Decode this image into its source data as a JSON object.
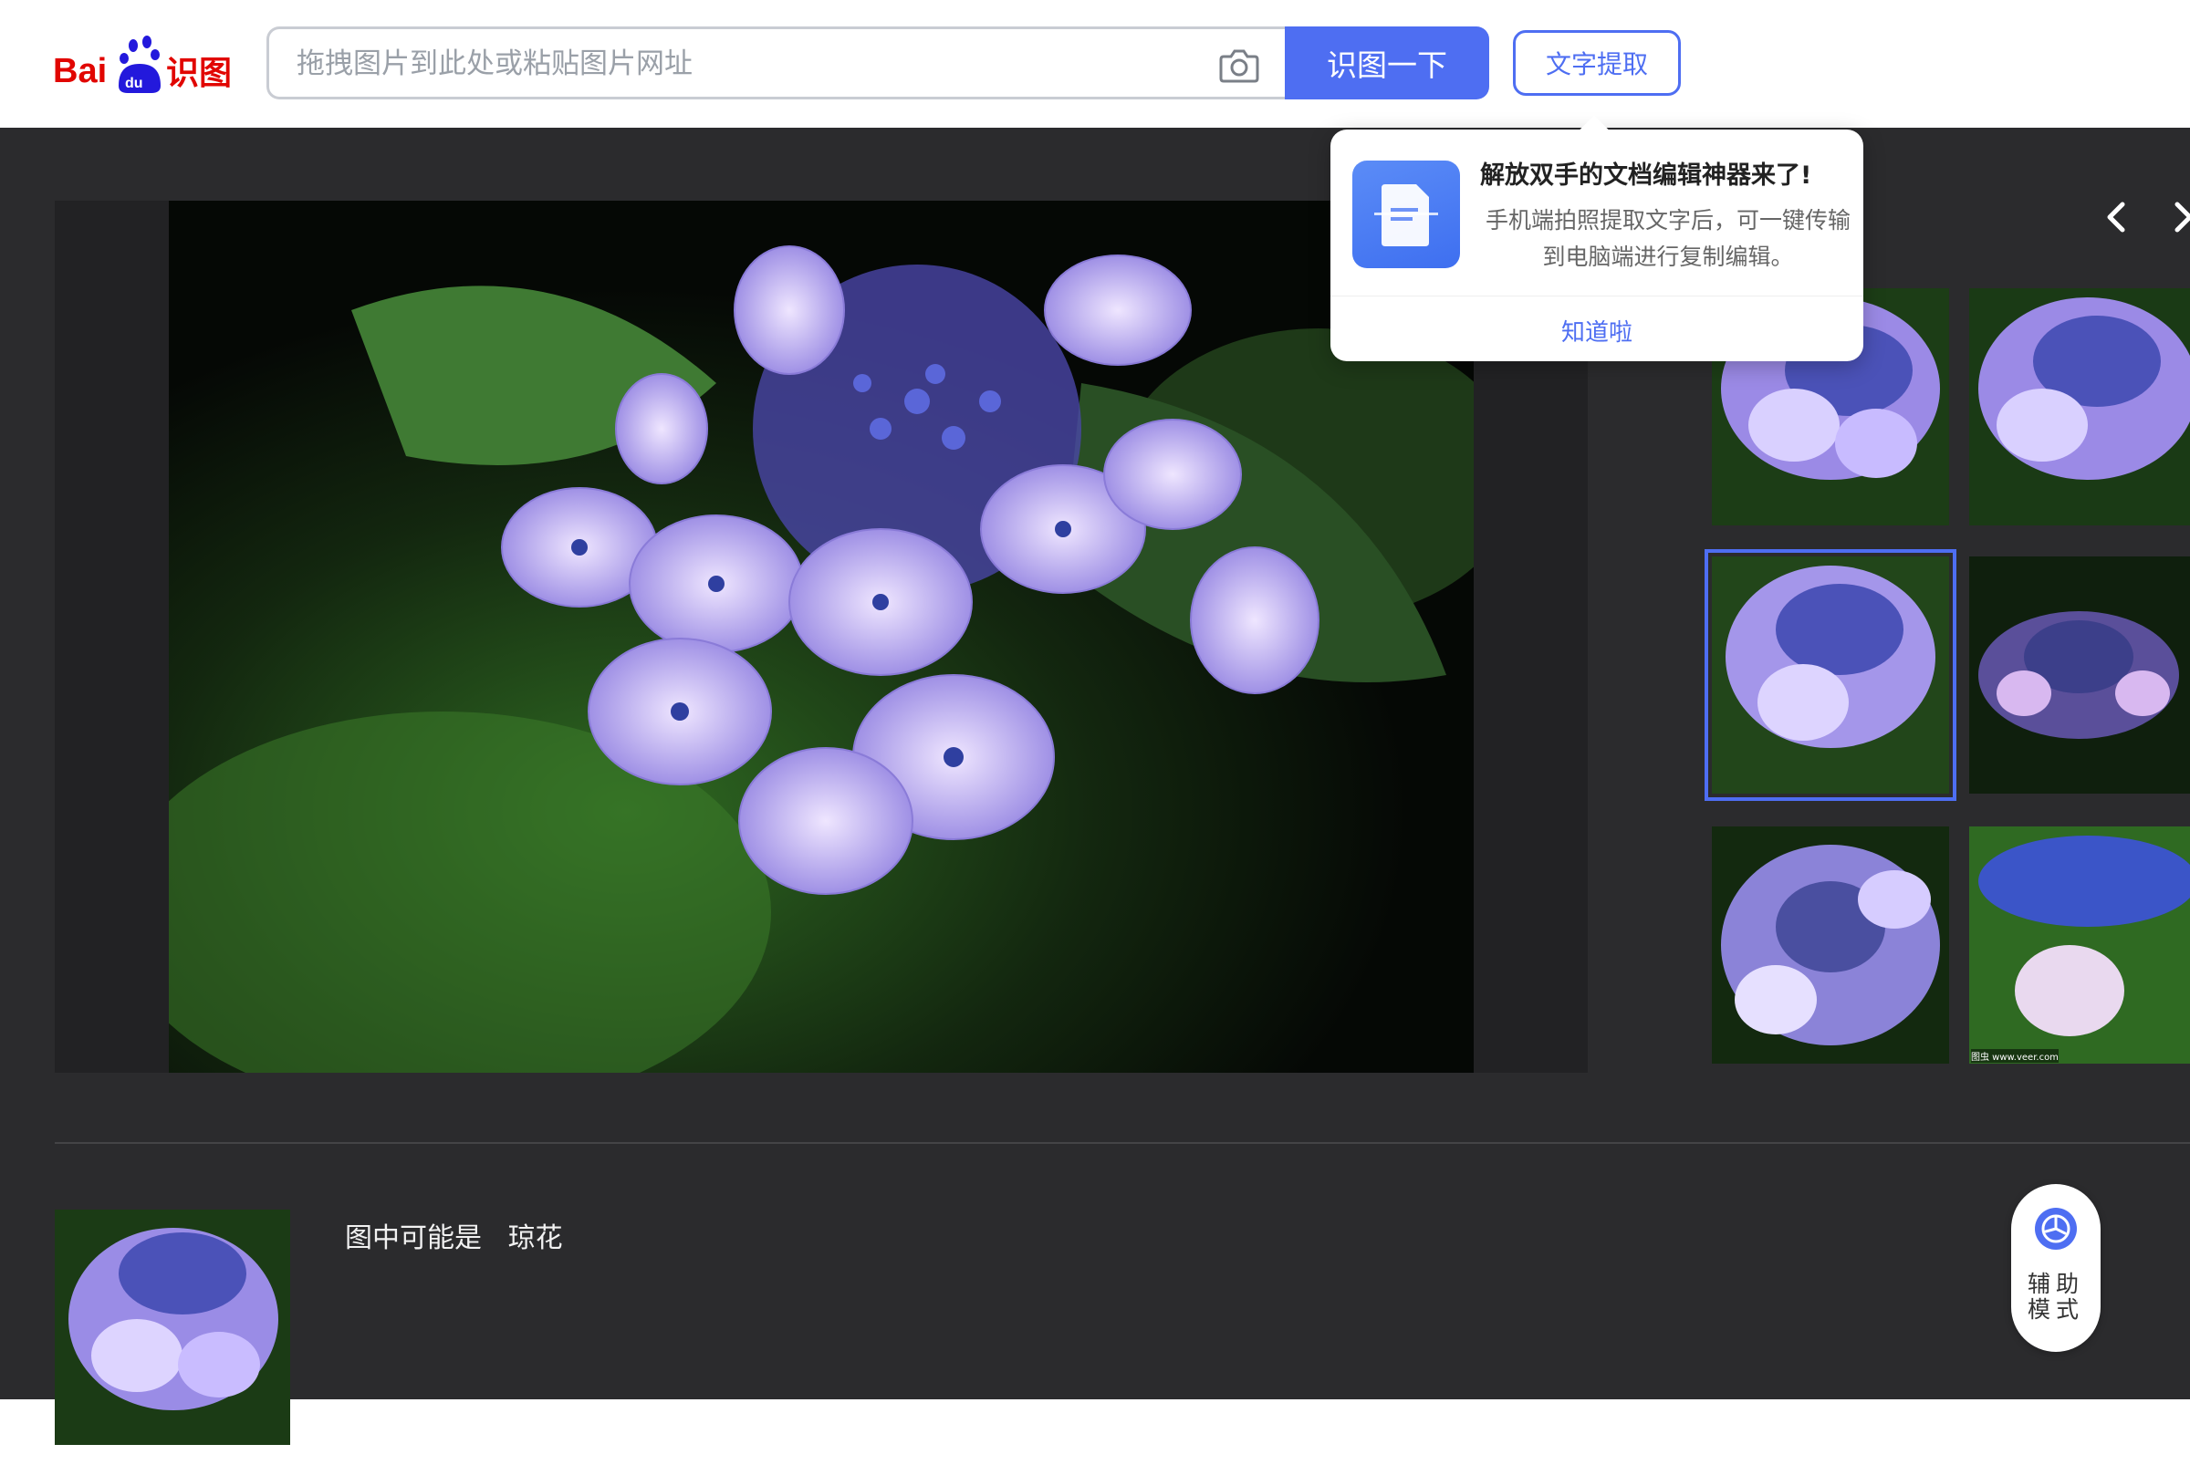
{
  "header": {
    "logo_text": "Bai du 识图",
    "search_placeholder": "拖拽图片到此处或粘贴图片网址",
    "search_button": "识图一下",
    "ocr_button": "文字提取"
  },
  "popover": {
    "title": "解放双手的文档编辑神器来了!",
    "description": "手机端拍照提取文字后，可一键传输到电脑端进行复制编辑。",
    "confirm": "知道啦"
  },
  "result": {
    "label": "图中可能是",
    "value": "琼花"
  },
  "similar": {
    "thumb_captions": [
      "",
      "",
      "",
      "",
      "",
      "图虫 www.veer.com"
    ]
  },
  "aux_mode": {
    "label": "辅助模式"
  },
  "colors": {
    "accent": "#4e6ef2",
    "dark_bg": "#2b2b2d",
    "logo_red": "#e10601",
    "logo_blue": "#2319dc"
  },
  "icons": {
    "camera": "camera-icon",
    "prev": "chevron-left-icon",
    "next": "chevron-right-icon",
    "aux": "accessibility-icon",
    "doc": "document-icon"
  }
}
